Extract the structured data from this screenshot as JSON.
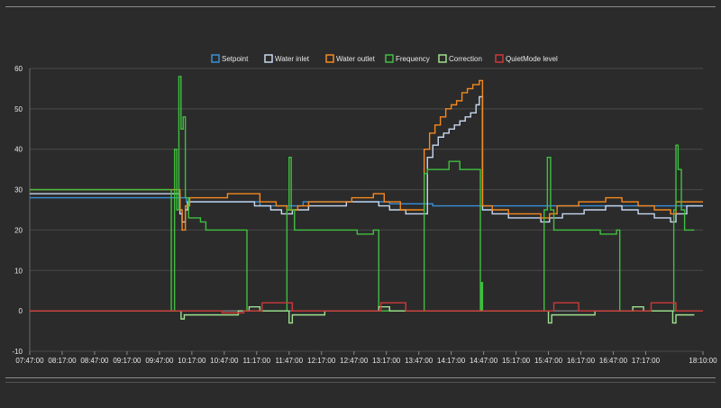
{
  "chart_data": {
    "type": "line",
    "title": "",
    "xlabel": "",
    "ylabel": "",
    "ylim": [
      -10,
      60
    ],
    "yticks": [
      -10,
      0,
      10,
      20,
      30,
      40,
      50,
      60
    ],
    "grid": true,
    "legend_position": "top",
    "x_tick_labels": [
      "07:47:00",
      "08:17:00",
      "08:47:00",
      "09:17:00",
      "09:47:00",
      "10:17:00",
      "10:47:00",
      "11:17:00",
      "11:47:00",
      "12:17:00",
      "12:47:00",
      "13:17:00",
      "13:47:00",
      "14:17:00",
      "14:47:00",
      "15:17:00",
      "15:47:00",
      "16:17:00",
      "16:47:00",
      "17:17:00",
      "18:10:00"
    ],
    "x_tick_minutes": [
      467,
      497,
      527,
      557,
      587,
      617,
      647,
      677,
      707,
      737,
      767,
      797,
      827,
      857,
      887,
      917,
      947,
      977,
      1007,
      1037,
      1090
    ],
    "x_range_minutes": [
      467,
      1090
    ],
    "series": [
      {
        "name": "Setpoint",
        "color": "#3a8fd8",
        "step": true,
        "points": [
          [
            467,
            28
          ],
          [
            605,
            28
          ],
          [
            612,
            27
          ],
          [
            640,
            27
          ],
          [
            680,
            26
          ],
          [
            720,
            27
          ],
          [
            760,
            27
          ],
          [
            800,
            26.5
          ],
          [
            840,
            26
          ],
          [
            900,
            26
          ],
          [
            950,
            26
          ],
          [
            1000,
            26
          ],
          [
            1050,
            26
          ],
          [
            1080,
            26
          ],
          [
            1090,
            26
          ]
        ]
      },
      {
        "name": "Water inlet",
        "color": "#c8d8f0",
        "step": true,
        "points": [
          [
            467,
            29
          ],
          [
            600,
            29
          ],
          [
            606,
            24
          ],
          [
            608,
            22
          ],
          [
            611,
            25
          ],
          [
            613,
            27
          ],
          [
            630,
            27
          ],
          [
            660,
            27
          ],
          [
            675,
            26
          ],
          [
            690,
            25
          ],
          [
            700,
            24
          ],
          [
            710,
            25
          ],
          [
            725,
            26
          ],
          [
            740,
            26
          ],
          [
            760,
            27
          ],
          [
            780,
            27
          ],
          [
            790,
            26
          ],
          [
            800,
            25
          ],
          [
            815,
            24
          ],
          [
            830,
            24
          ],
          [
            835,
            38
          ],
          [
            840,
            41
          ],
          [
            845,
            43
          ],
          [
            850,
            44
          ],
          [
            855,
            45
          ],
          [
            860,
            46
          ],
          [
            865,
            47
          ],
          [
            870,
            48
          ],
          [
            875,
            49
          ],
          [
            880,
            51
          ],
          [
            883,
            53
          ],
          [
            886,
            25
          ],
          [
            895,
            24
          ],
          [
            910,
            23
          ],
          [
            925,
            23
          ],
          [
            940,
            22
          ],
          [
            948,
            23
          ],
          [
            960,
            24
          ],
          [
            980,
            25
          ],
          [
            1000,
            26
          ],
          [
            1015,
            25
          ],
          [
            1030,
            24
          ],
          [
            1045,
            23
          ],
          [
            1060,
            22
          ],
          [
            1065,
            24
          ],
          [
            1075,
            26
          ],
          [
            1090,
            26
          ]
        ]
      },
      {
        "name": "Water outlet",
        "color": "#f5891e",
        "step": true,
        "points": [
          [
            467,
            30
          ],
          [
            600,
            30
          ],
          [
            606,
            25
          ],
          [
            608,
            20
          ],
          [
            611,
            26
          ],
          [
            615,
            28
          ],
          [
            630,
            28
          ],
          [
            650,
            29
          ],
          [
            680,
            27
          ],
          [
            695,
            26
          ],
          [
            705,
            25
          ],
          [
            715,
            26
          ],
          [
            725,
            27
          ],
          [
            745,
            27
          ],
          [
            765,
            28
          ],
          [
            785,
            29
          ],
          [
            795,
            27
          ],
          [
            810,
            25
          ],
          [
            825,
            25
          ],
          [
            832,
            40
          ],
          [
            837,
            44
          ],
          [
            842,
            46
          ],
          [
            847,
            48
          ],
          [
            852,
            50
          ],
          [
            857,
            51
          ],
          [
            862,
            52
          ],
          [
            867,
            54
          ],
          [
            872,
            55
          ],
          [
            877,
            56
          ],
          [
            883,
            57
          ],
          [
            886,
            26
          ],
          [
            895,
            25
          ],
          [
            910,
            24
          ],
          [
            925,
            24
          ],
          [
            940,
            23
          ],
          [
            948,
            24
          ],
          [
            955,
            26
          ],
          [
            975,
            27
          ],
          [
            1000,
            28
          ],
          [
            1015,
            27
          ],
          [
            1030,
            26
          ],
          [
            1045,
            25
          ],
          [
            1060,
            24
          ],
          [
            1065,
            27
          ],
          [
            1075,
            27
          ],
          [
            1090,
            27
          ]
        ]
      },
      {
        "name": "Frequency",
        "color": "#3fbf3f",
        "step": true,
        "points": [
          [
            467,
            30
          ],
          [
            595,
            30
          ],
          [
            598,
            0
          ],
          [
            601,
            40
          ],
          [
            603,
            25
          ],
          [
            605,
            58
          ],
          [
            607,
            45
          ],
          [
            609,
            48
          ],
          [
            611,
            28
          ],
          [
            614,
            23
          ],
          [
            620,
            23
          ],
          [
            625,
            22
          ],
          [
            630,
            20
          ],
          [
            660,
            20
          ],
          [
            666,
            20
          ],
          [
            668,
            0
          ],
          [
            703,
            0
          ],
          [
            705,
            25
          ],
          [
            707,
            38
          ],
          [
            709,
            25
          ],
          [
            712,
            20
          ],
          [
            750,
            20
          ],
          [
            770,
            19
          ],
          [
            785,
            20
          ],
          [
            790,
            0
          ],
          [
            830,
            0
          ],
          [
            832,
            34
          ],
          [
            835,
            35
          ],
          [
            850,
            35
          ],
          [
            855,
            37
          ],
          [
            865,
            35
          ],
          [
            880,
            35
          ],
          [
            884,
            0
          ],
          [
            885,
            7
          ],
          [
            886,
            0
          ],
          [
            940,
            0
          ],
          [
            943,
            25
          ],
          [
            946,
            38
          ],
          [
            949,
            25
          ],
          [
            952,
            20
          ],
          [
            975,
            20
          ],
          [
            995,
            19
          ],
          [
            1010,
            20
          ],
          [
            1013,
            0
          ],
          [
            1060,
            0
          ],
          [
            1063,
            25
          ],
          [
            1065,
            41
          ],
          [
            1067,
            35
          ],
          [
            1070,
            25
          ],
          [
            1073,
            20
          ],
          [
            1082,
            20
          ],
          [
            1082,
            20
          ]
        ]
      },
      {
        "name": "Correction",
        "color": "#9fe08f",
        "step": true,
        "points": [
          [
            467,
            0
          ],
          [
            605,
            0
          ],
          [
            607,
            -2
          ],
          [
            610,
            -1
          ],
          [
            640,
            -1
          ],
          [
            660,
            0
          ],
          [
            670,
            1
          ],
          [
            680,
            0
          ],
          [
            705,
            0
          ],
          [
            707,
            -3
          ],
          [
            710,
            -1
          ],
          [
            720,
            -1
          ],
          [
            740,
            0
          ],
          [
            770,
            0
          ],
          [
            790,
            1
          ],
          [
            800,
            0
          ],
          [
            820,
            0
          ],
          [
            850,
            0
          ],
          [
            880,
            0
          ],
          [
            920,
            0
          ],
          [
            945,
            0
          ],
          [
            947,
            -3
          ],
          [
            950,
            -1
          ],
          [
            970,
            -1
          ],
          [
            990,
            0
          ],
          [
            1010,
            0
          ],
          [
            1025,
            1
          ],
          [
            1035,
            0
          ],
          [
            1060,
            0
          ],
          [
            1062,
            -3
          ],
          [
            1065,
            -1
          ],
          [
            1082,
            -1
          ]
        ]
      },
      {
        "name": "QuietMode level",
        "color": "#d03838",
        "step": true,
        "points": [
          [
            467,
            0
          ],
          [
            640,
            0
          ],
          [
            645,
            -0.5
          ],
          [
            660,
            -0.5
          ],
          [
            665,
            0
          ],
          [
            680,
            0
          ],
          [
            682,
            2
          ],
          [
            705,
            2
          ],
          [
            710,
            0
          ],
          [
            790,
            0
          ],
          [
            792,
            2
          ],
          [
            810,
            2
          ],
          [
            815,
            0
          ],
          [
            950,
            0
          ],
          [
            952,
            2
          ],
          [
            970,
            2
          ],
          [
            975,
            0
          ],
          [
            1040,
            0
          ],
          [
            1042,
            2
          ],
          [
            1060,
            2
          ],
          [
            1065,
            0
          ],
          [
            1090,
            0
          ]
        ]
      }
    ]
  }
}
